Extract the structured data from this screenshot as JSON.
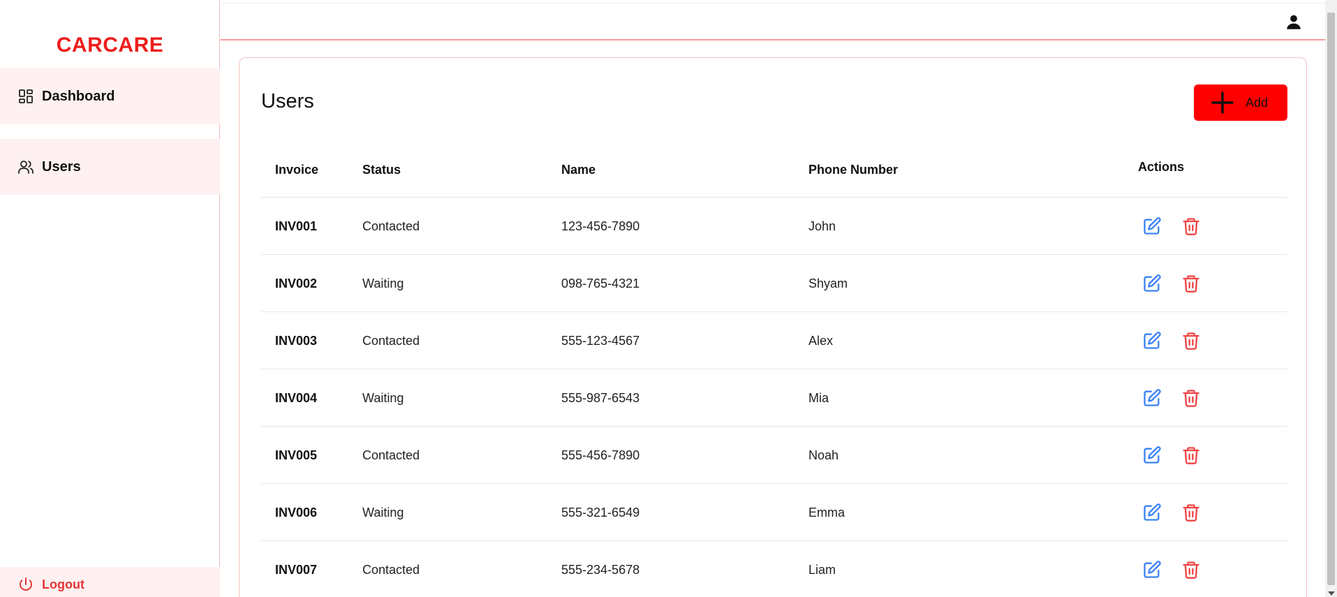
{
  "app": {
    "brand": "CARCARE"
  },
  "sidebar": {
    "items": [
      {
        "label": "Dashboard",
        "icon": "dashboard-grid-icon"
      },
      {
        "label": "Users",
        "icon": "users-icon"
      }
    ],
    "logout": {
      "label": "Logout",
      "icon": "power-icon"
    }
  },
  "topbar": {
    "user_icon": "user-icon"
  },
  "page": {
    "title": "Users",
    "add_button": {
      "label": "Add",
      "icon": "plus-icon"
    }
  },
  "table": {
    "headers": {
      "invoice": "Invoice",
      "status": "Status",
      "name": "Name",
      "phone": "Phone Number",
      "actions": "Actions"
    },
    "rows": [
      {
        "invoice": "INV001",
        "status": "Contacted",
        "name": "123-456-7890",
        "phone": "John"
      },
      {
        "invoice": "INV002",
        "status": "Waiting",
        "name": "098-765-4321",
        "phone": "Shyam"
      },
      {
        "invoice": "INV003",
        "status": "Contacted",
        "name": "555-123-4567",
        "phone": "Alex"
      },
      {
        "invoice": "INV004",
        "status": "Waiting",
        "name": "555-987-6543",
        "phone": "Mia"
      },
      {
        "invoice": "INV005",
        "status": "Contacted",
        "name": "555-456-7890",
        "phone": "Noah"
      },
      {
        "invoice": "INV006",
        "status": "Waiting",
        "name": "555-321-6549",
        "phone": "Emma"
      },
      {
        "invoice": "INV007",
        "status": "Contacted",
        "name": "555-234-5678",
        "phone": "Liam"
      }
    ],
    "row_actions": {
      "edit_icon": "edit-icon",
      "delete_icon": "trash-icon"
    }
  },
  "colors": {
    "brand": "#ee1c1c",
    "add_button": "#ff0000",
    "edit": "#3b82f6",
    "delete": "#ef4444",
    "nav_bg": "#fff1f1"
  }
}
